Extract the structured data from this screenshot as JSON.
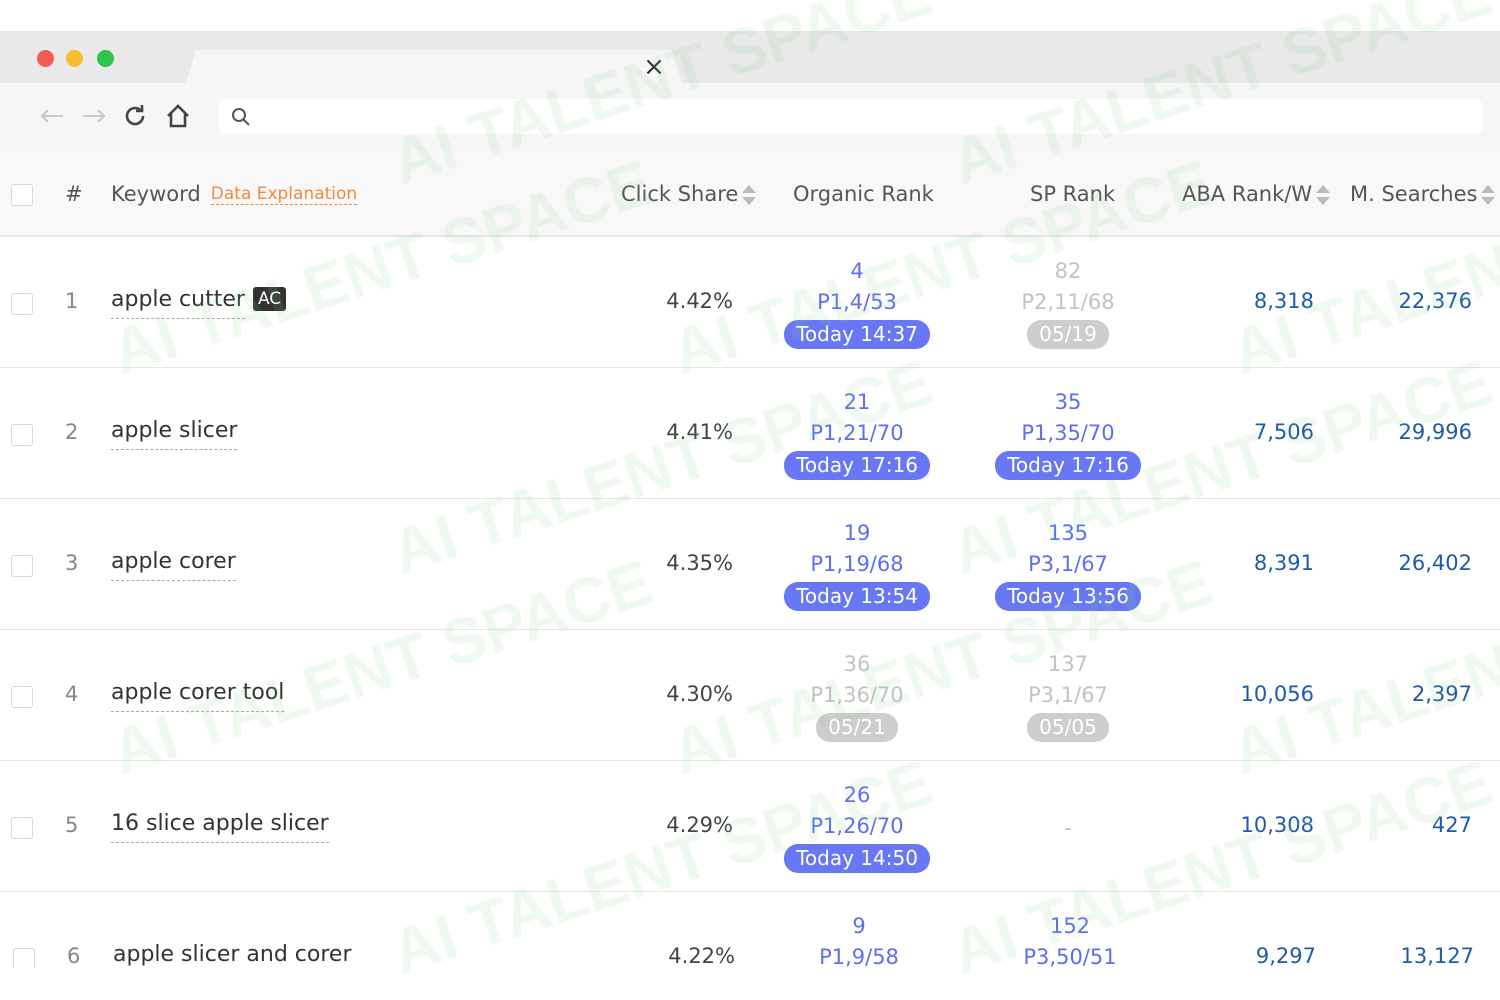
{
  "browser": {
    "tab_close_glyph": "×"
  },
  "columns": {
    "index": "#",
    "keyword": "Keyword",
    "data_explanation": "Data Explanation",
    "click_share": "Click Share",
    "organic_rank": "Organic Rank",
    "sp_rank": "SP Rank",
    "aba_rank": "ABA Rank/W",
    "monthly_searches": "M. Searches"
  },
  "rows": [
    {
      "index": "1",
      "keyword": "apple cutter",
      "badge": "AC",
      "click_share": "4.42%",
      "organic": {
        "rank": "4",
        "page": "P1,4/53",
        "time": "Today 14:37",
        "muted": false
      },
      "sp": {
        "rank": "82",
        "page": "P2,11/68",
        "time": "05/19",
        "muted": true
      },
      "aba": "8,318",
      "searches": "22,376"
    },
    {
      "index": "2",
      "keyword": "apple slicer",
      "badge": "",
      "click_share": "4.41%",
      "organic": {
        "rank": "21",
        "page": "P1,21/70",
        "time": "Today 17:16",
        "muted": false
      },
      "sp": {
        "rank": "35",
        "page": "P1,35/70",
        "time": "Today 17:16",
        "muted": false
      },
      "aba": "7,506",
      "searches": "29,996"
    },
    {
      "index": "3",
      "keyword": "apple corer",
      "badge": "",
      "click_share": "4.35%",
      "organic": {
        "rank": "19",
        "page": "P1,19/68",
        "time": "Today 13:54",
        "muted": false
      },
      "sp": {
        "rank": "135",
        "page": "P3,1/67",
        "time": "Today 13:56",
        "muted": false
      },
      "aba": "8,391",
      "searches": "26,402"
    },
    {
      "index": "4",
      "keyword": "apple corer tool",
      "badge": "",
      "click_share": "4.30%",
      "organic": {
        "rank": "36",
        "page": "P1,36/70",
        "time": "05/21",
        "muted": true
      },
      "sp": {
        "rank": "137",
        "page": "P3,1/67",
        "time": "05/05",
        "muted": true
      },
      "aba": "10,056",
      "searches": "2,397"
    },
    {
      "index": "5",
      "keyword": "16 slice apple slicer",
      "badge": "",
      "click_share": "4.29%",
      "organic": {
        "rank": "26",
        "page": "P1,26/70",
        "time": "Today 14:50",
        "muted": false
      },
      "sp": {
        "dash": "-"
      },
      "aba": "10,308",
      "searches": "427"
    },
    {
      "index": "6",
      "keyword": "apple slicer and corer",
      "badge": "",
      "click_share": "4.22%",
      "organic": {
        "rank": "9",
        "page": "P1,9/58",
        "time": "",
        "muted": false
      },
      "sp": {
        "rank": "152",
        "page": "P3,50/51",
        "time": "",
        "muted": false
      },
      "aba": "9,297",
      "searches": "13,127"
    }
  ],
  "watermark": "AI TALENT SPACE",
  "colors": {
    "accent": "#6878f4",
    "link": "#1e5aa8",
    "explain": "#f08a3c",
    "muted": "#cdcdcd"
  }
}
